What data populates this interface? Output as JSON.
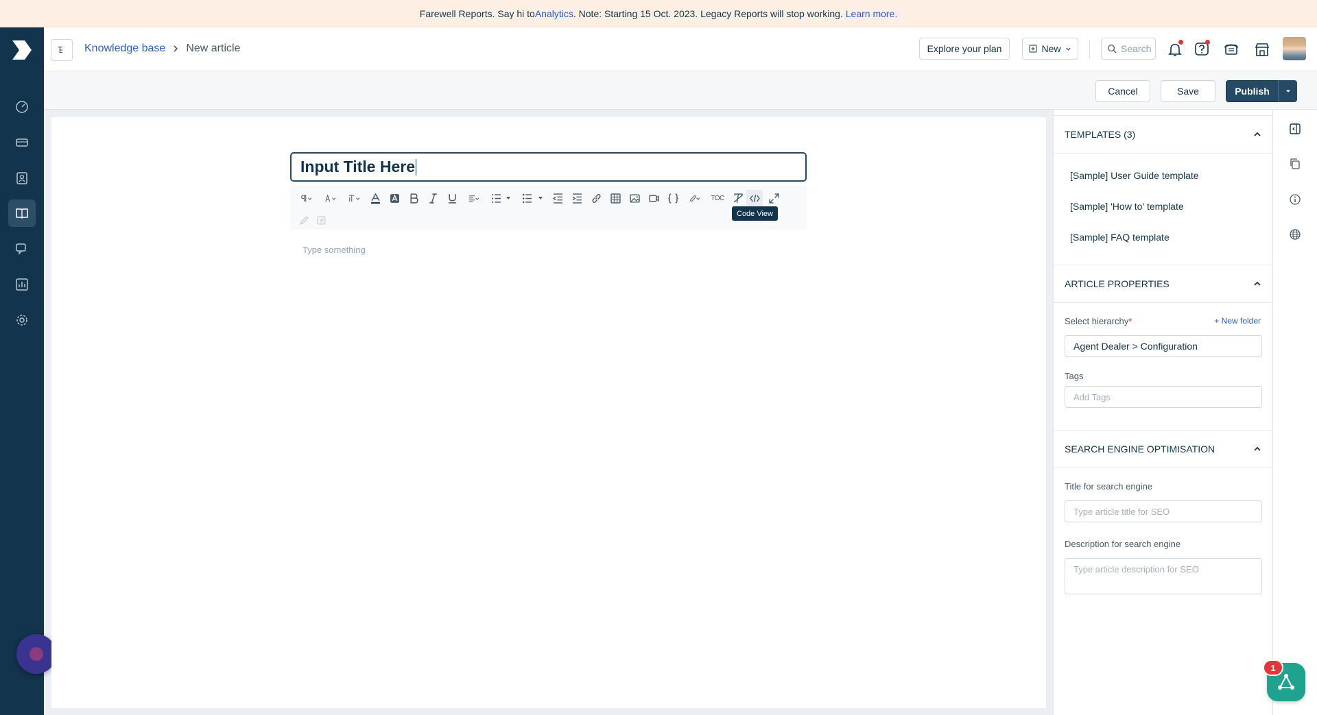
{
  "banner": {
    "text_before": "Farewell Reports. Say hi to ",
    "analytics_link": "Analytics",
    "text_after": ". Note: Starting 15 Oct. 2023. Legacy Reports will stop working. ",
    "learn_more": "Learn more."
  },
  "breadcrumb": {
    "parent": "Knowledge base",
    "current": "New article"
  },
  "header": {
    "explore_plan": "Explore your plan",
    "new_label": "New",
    "search_placeholder": "Search"
  },
  "actions": {
    "cancel": "Cancel",
    "save": "Save",
    "publish": "Publish"
  },
  "editor": {
    "title_value": "Input Title Here",
    "body_placeholder": "Type something",
    "tooltip": "Code View",
    "toc_label": "TOC"
  },
  "templates": {
    "heading": "TEMPLATES (3)",
    "items": [
      "[Sample] User Guide template",
      "[Sample] 'How to' template",
      "[Sample] FAQ template"
    ]
  },
  "article_properties": {
    "heading": "ARTICLE PROPERTIES",
    "hierarchy_label": "Select hierarchy",
    "required_mark": "*",
    "new_folder": "+ New folder",
    "hierarchy_value": "Agent Dealer > Configuration",
    "tags_label": "Tags",
    "tags_placeholder": "Add Tags"
  },
  "seo": {
    "heading": "SEARCH ENGINE OPTIMISATION",
    "title_label": "Title for search engine",
    "title_placeholder": "Type article title for SEO",
    "desc_label": "Description for search engine",
    "desc_placeholder": "Type article description for SEO"
  },
  "notifications": {
    "fab_badge": "1"
  },
  "colors": {
    "nav_bg": "#12344d",
    "primary": "#264966",
    "link": "#2c5cc5",
    "banner_bg": "#fdefe4",
    "fab": "#1fa38e",
    "badge": "#e43538"
  }
}
